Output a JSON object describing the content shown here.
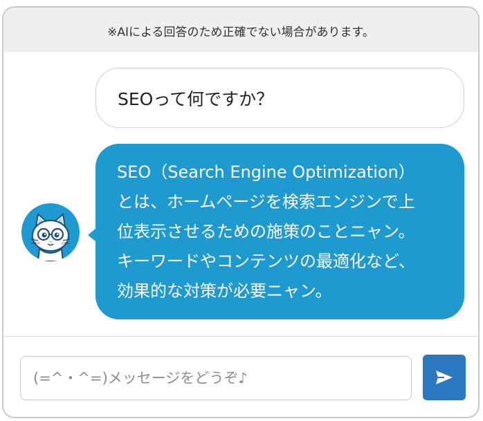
{
  "notice": {
    "text": "※AIによる回答のため正確でない場合があります。"
  },
  "conversation": {
    "user_message": "SEOって何ですか？",
    "bot_message_lines": [
      "SEO（Search Engine Optimization）",
      "とは、ホームページを検索エンジンで上",
      "位表示させるための施策のことニャン。",
      "キーワードやコンテンツの最適化など、",
      "効果的な対策が必要ニャン。"
    ],
    "bot_avatar": "cat-mascot-avatar"
  },
  "composer": {
    "placeholder": "(=^・^=)メッセージをどうぞ♪",
    "value": "",
    "send_icon": "send-arrow-icon"
  },
  "colors": {
    "accent": "#1f9ad1",
    "send_button": "#2a78bf",
    "notice_bg": "#efefef"
  }
}
